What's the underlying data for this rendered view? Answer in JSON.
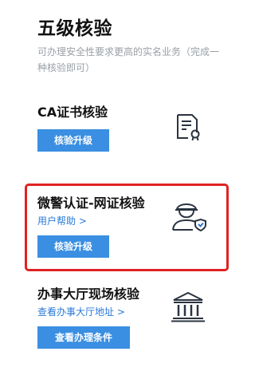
{
  "page": {
    "title": "五级核验",
    "subtitle": "可办理安全性要求更高的实名业务（完成一种核验即可）"
  },
  "methods": [
    {
      "title": "CA证书核验",
      "button_label": "核验升级",
      "icon": "certificate-icon"
    },
    {
      "title": "微警认证-网证核验",
      "link_label": "用户帮助 >",
      "button_label": "核验升级",
      "icon": "police-officer-icon",
      "highlighted": true
    },
    {
      "title": "办事大厅现场核验",
      "link_label": "查看办事大厅地址 >",
      "button_label": "查看办理条件",
      "icon": "government-building-icon"
    }
  ],
  "colors": {
    "button_bg": "#3a8fe2",
    "link": "#2a7ad8",
    "highlight_border": "#e02222",
    "subtitle": "#9aa0a6"
  }
}
